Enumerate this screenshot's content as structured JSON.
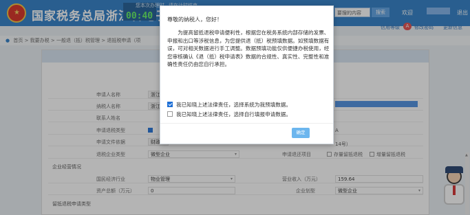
{
  "header": {
    "title": "国家税务总局浙江省电子税",
    "notice_left": "您本次办理时",
    "notice_right": "请在计时结束",
    "timer": "00:40",
    "search_placeholder": "要搜的内容",
    "search_button": "搜索",
    "welcome": "欢迎",
    "logout": "退出",
    "links": {
      "credit_level": "信用等级",
      "credit_badge": "A",
      "change_password": "修改密码",
      "change_info": "更新信息"
    }
  },
  "breadcrumb": [
    "首页",
    "我要办税",
    "一般退（抵）税管理",
    "退抵税申请（项"
  ],
  "modal": {
    "greeting": "尊敬的纳税人，您好！",
    "paragraph": "为提高留抵退税申请便利性，根据您在税务系统内部存储的发票、申报和出口等涉税信息，为您提供退（抵）税预填数据。如预填数据有误，可对相关数据进行手工调整。数据预填功能仅供便捷办税使用，经您审核确认《退（抵）税申请表》数据的合规性、真实性、完整性和准确性责任仍由您自行承担。",
    "option1": "我已知晓上述法律责任，选择系统为我预填数据。",
    "option2": "我已知晓上述法律责任，选择自行填报申请数据。",
    "confirm": "确定"
  },
  "form": {
    "applicant_name_label": "申请人名称",
    "applicant_name_value": "浙江",
    "taxpayer_name_label": "纳税人名称",
    "taxpayer_name_value": "浙江",
    "contact_label": "联系人姓名",
    "apply_type_label": "申请退税类型",
    "apply_basis_label": "申请文件依据",
    "apply_basis_value": "财政",
    "apply_basis_suffix": "14号）",
    "refund_enterprise_type_label": "退税企业类型",
    "refund_enterprise_type_value": "微型企业",
    "refund_project_label": "申请退还项目",
    "refund_project_opt1": "存量留抵退税",
    "refund_project_opt2": "增量留抵退税",
    "letter_a": "A",
    "enterprise_info_title": "企业经营情况",
    "industry_label": "国民经济行业",
    "industry_value": "物业管理",
    "revenue_label": "营业收入（万元）",
    "revenue_value": "159.64",
    "assets_label": "资产总额（万元）",
    "assets_value": "0",
    "enterprise_scale_label": "企业划型",
    "enterprise_scale_value": "微型企业",
    "refund_type_title": "留抵退税申请类型"
  }
}
